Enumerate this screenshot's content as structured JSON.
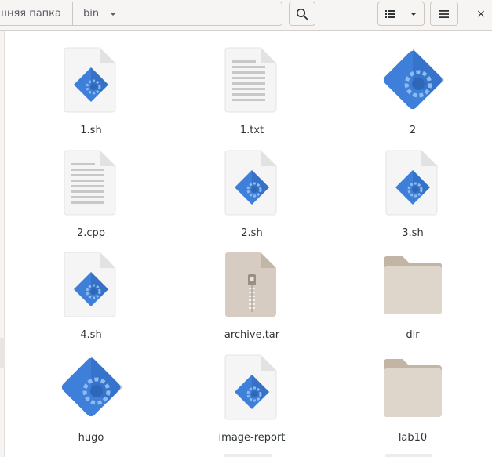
{
  "header": {
    "breadcrumbs": [
      {
        "label": "шняя папка"
      },
      {
        "label": "bin"
      }
    ],
    "buttons": {
      "search_icon": "search-icon",
      "view_icon": "list-view-icon",
      "view_menu_icon": "chevron-down-icon",
      "main_menu_icon": "hamburger-menu-icon",
      "close_label": "×"
    }
  },
  "files": [
    {
      "name": "1.sh",
      "kind": "script"
    },
    {
      "name": "1.txt",
      "kind": "text"
    },
    {
      "name": "2",
      "kind": "executable"
    },
    {
      "name": "2.cpp",
      "kind": "text"
    },
    {
      "name": "2.sh",
      "kind": "script"
    },
    {
      "name": "3.sh",
      "kind": "script"
    },
    {
      "name": "4.sh",
      "kind": "script"
    },
    {
      "name": "archive.tar",
      "kind": "archive"
    },
    {
      "name": "dir",
      "kind": "folder"
    },
    {
      "name": "hugo",
      "kind": "executable"
    },
    {
      "name": "image-report",
      "kind": "script"
    },
    {
      "name": "lab10",
      "kind": "folder"
    }
  ],
  "colors": {
    "accent_blue": "#3d7fd9",
    "folder": "#cdc2b6",
    "archive": "#d6ccc1",
    "page": "#f5f5f5"
  }
}
